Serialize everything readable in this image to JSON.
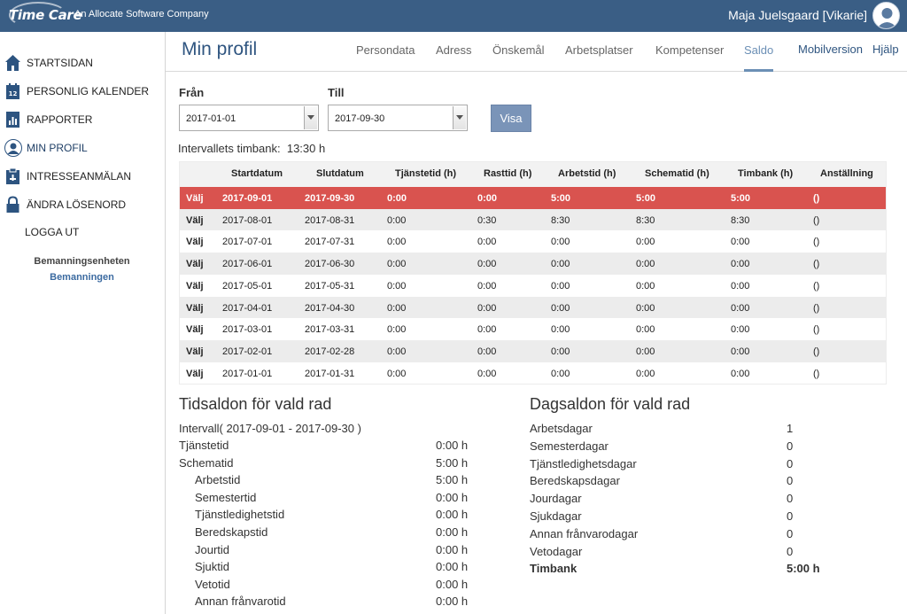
{
  "topbar": {
    "logo_text": "Time Care",
    "tagline": "An Allocate Software Company",
    "user_name": "Maja Juelsgaard [Vikarie]"
  },
  "sidebar": {
    "items": [
      {
        "label": "Startsidan",
        "icon": "home-icon"
      },
      {
        "label": "Personlig kalender",
        "icon": "calendar-icon"
      },
      {
        "label": "Rapporter",
        "icon": "report-icon"
      },
      {
        "label": "Min profil",
        "icon": "user-icon"
      },
      {
        "label": "Intresseanmälan",
        "icon": "interest-icon"
      },
      {
        "label": "Ändra lösenord",
        "icon": "lock-icon"
      }
    ],
    "logout": "LOGGA UT",
    "unit_title": "Bemanningsenheten",
    "unit_name": "Bemanningen"
  },
  "header": {
    "title": "Min profil",
    "tabs": [
      "Persondata",
      "Adress",
      "Önskemål",
      "Arbetsplatser",
      "Kompetenser",
      "Saldo"
    ],
    "active_tab": "Saldo",
    "mobile": "Mobilversion",
    "help": "Hjälp"
  },
  "filters": {
    "from_label": "Från",
    "from_value": "2017-01-01",
    "to_label": "Till",
    "to_value": "2017-09-30",
    "button": "Visa",
    "interval_label": "Intervallets timbank:",
    "interval_value": "13:30 h"
  },
  "table": {
    "headers": [
      "Startdatum",
      "Slutdatum",
      "Tjänstetid (h)",
      "Rasttid (h)",
      "Arbetstid (h)",
      "Schematid (h)",
      "Timbank (h)",
      "Anställning"
    ],
    "select_label": "Välj",
    "rows": [
      [
        "2017-09-01",
        "2017-09-30",
        "0:00",
        "0:00",
        "5:00",
        "5:00",
        "5:00",
        "()"
      ],
      [
        "2017-08-01",
        "2017-08-31",
        "0:00",
        "0:30",
        "8:30",
        "8:30",
        "8:30",
        "()"
      ],
      [
        "2017-07-01",
        "2017-07-31",
        "0:00",
        "0:00",
        "0:00",
        "0:00",
        "0:00",
        "()"
      ],
      [
        "2017-06-01",
        "2017-06-30",
        "0:00",
        "0:00",
        "0:00",
        "0:00",
        "0:00",
        "()"
      ],
      [
        "2017-05-01",
        "2017-05-31",
        "0:00",
        "0:00",
        "0:00",
        "0:00",
        "0:00",
        "()"
      ],
      [
        "2017-04-01",
        "2017-04-30",
        "0:00",
        "0:00",
        "0:00",
        "0:00",
        "0:00",
        "()"
      ],
      [
        "2017-03-01",
        "2017-03-31",
        "0:00",
        "0:00",
        "0:00",
        "0:00",
        "0:00",
        "()"
      ],
      [
        "2017-02-01",
        "2017-02-28",
        "0:00",
        "0:00",
        "0:00",
        "0:00",
        "0:00",
        "()"
      ],
      [
        "2017-01-01",
        "2017-01-31",
        "0:00",
        "0:00",
        "0:00",
        "0:00",
        "0:00",
        "()"
      ]
    ],
    "selected_row": 0
  },
  "time_balance": {
    "title": "Tidsaldon för vald rad",
    "interval": "Intervall( 2017-09-01 - 2017-09-30 )",
    "rows": [
      {
        "label": "Tjänstetid",
        "value": "0:00 h",
        "indent": false
      },
      {
        "label": "Schematid",
        "value": "5:00 h",
        "indent": false
      },
      {
        "label": "Arbetstid",
        "value": "5:00 h",
        "indent": true
      },
      {
        "label": "Semestertid",
        "value": "0:00 h",
        "indent": true
      },
      {
        "label": "Tjänstledighetstid",
        "value": "0:00 h",
        "indent": true
      },
      {
        "label": "Beredskapstid",
        "value": "0:00 h",
        "indent": true
      },
      {
        "label": "Jourtid",
        "value": "0:00 h",
        "indent": true
      },
      {
        "label": "Sjuktid",
        "value": "0:00 h",
        "indent": true
      },
      {
        "label": "Vetotid",
        "value": "0:00 h",
        "indent": true
      },
      {
        "label": "Annan frånvarotid",
        "value": "0:00 h",
        "indent": true
      }
    ]
  },
  "day_balance": {
    "title": "Dagsaldon för vald rad",
    "rows": [
      {
        "label": "Arbetsdagar",
        "value": "1",
        "bold": false
      },
      {
        "label": "Semesterdagar",
        "value": "0",
        "bold": false
      },
      {
        "label": "Tjänstledighetsdagar",
        "value": "0",
        "bold": false
      },
      {
        "label": "Beredskapsdagar",
        "value": "0",
        "bold": false
      },
      {
        "label": "Jourdagar",
        "value": "0",
        "bold": false
      },
      {
        "label": "Sjukdagar",
        "value": "0",
        "bold": false
      },
      {
        "label": "Annan frånvarodagar",
        "value": "0",
        "bold": false
      },
      {
        "label": "Vetodagar",
        "value": "0",
        "bold": false
      },
      {
        "label": "Timbank",
        "value": "5:00 h",
        "bold": true
      }
    ]
  },
  "colors": {
    "topbar": "#3a5e85",
    "selected_row": "#d9534f",
    "accent": "#2f5580",
    "button": "#7a94b8"
  }
}
